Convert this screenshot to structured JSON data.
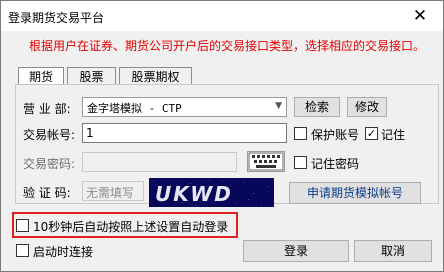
{
  "window": {
    "title": "登录期货交易平台",
    "close_glyph": "✕"
  },
  "notice": "根据用户在证券、期货公司开户后的交易接口类型，选择相应的交易接口。",
  "tabs": [
    {
      "label": "期货",
      "active": true
    },
    {
      "label": "股票",
      "active": false
    },
    {
      "label": "股票期权",
      "active": false
    }
  ],
  "form": {
    "broker_label": "营 业 部:",
    "broker_value": "金字塔模拟 - CTP",
    "search_button": "检索",
    "modify_button": "修改",
    "account_label": "交易帐号:",
    "account_value": "1",
    "save_account_label": "保护账号",
    "save_account_checked": false,
    "remember_label": "记住",
    "remember_checked": true,
    "password_label": "交易密码:",
    "remember_password_label": "记住密码",
    "remember_password_checked": false,
    "captcha_label": "验 证 码:",
    "captcha_placeholder": "无需填写",
    "captcha_code": "UKWD",
    "apply_button": "申请期货模拟帐号"
  },
  "options": {
    "auto_login_label": "10秒钟后自动按照上述设置自动登录",
    "auto_login_checked": false,
    "connect_on_start_label": "启动时连接",
    "connect_on_start_checked": false
  },
  "buttons": {
    "login": "登录",
    "cancel": "取消"
  },
  "colors": {
    "notice": "#e00000",
    "highlight_box": "#e02020",
    "captcha_bg": "#07085a"
  },
  "icons": {
    "keyboard": "soft-keyboard-icon",
    "dropdown": "chevron-down-icon"
  }
}
